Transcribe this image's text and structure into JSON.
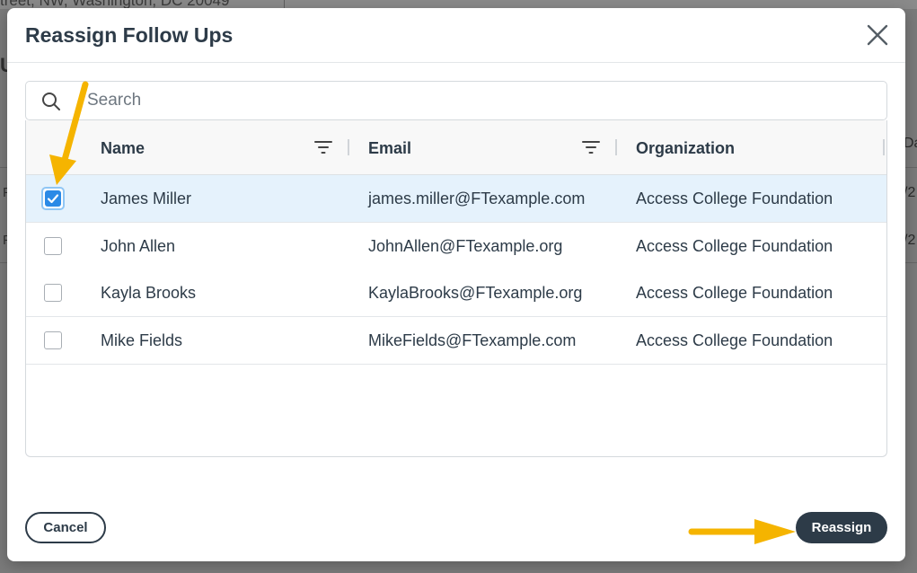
{
  "background": {
    "address_fragment": "treet, NW, Washington, DC 20049",
    "header_letter": "U",
    "row_marks": [
      "F",
      "F"
    ],
    "column_fragment": "Da",
    "row_fragments": [
      "/2",
      "/2"
    ]
  },
  "dialog": {
    "title": "Reassign Follow Ups",
    "search": {
      "placeholder": "Search",
      "value": ""
    },
    "columns": [
      "Name",
      "Email",
      "Organization"
    ],
    "rows": [
      {
        "name": "James Miller",
        "email": "james.miller@FTexample.com",
        "organization": "Access College Foundation",
        "checked": true
      },
      {
        "name": "John Allen",
        "email": "JohnAllen@FTexample.org",
        "organization": "Access College Foundation",
        "checked": false
      },
      {
        "name": "Kayla Brooks",
        "email": "KaylaBrooks@FTexample.org",
        "organization": "Access College Foundation",
        "checked": false
      },
      {
        "name": "Mike Fields",
        "email": "MikeFields@FTexample.com",
        "organization": "Access College Foundation",
        "checked": false
      }
    ],
    "cancel_label": "Cancel",
    "reassign_label": "Reassign"
  },
  "colors": {
    "primary": "#2d3b48",
    "selected_row": "#e5f2fc",
    "checkbox_checked": "#2b8ae6",
    "annotation_arrow": "#f5b400"
  },
  "icons": [
    "search-icon",
    "close-icon",
    "filter-icon",
    "check-icon",
    "arrow-annotation-icon"
  ]
}
